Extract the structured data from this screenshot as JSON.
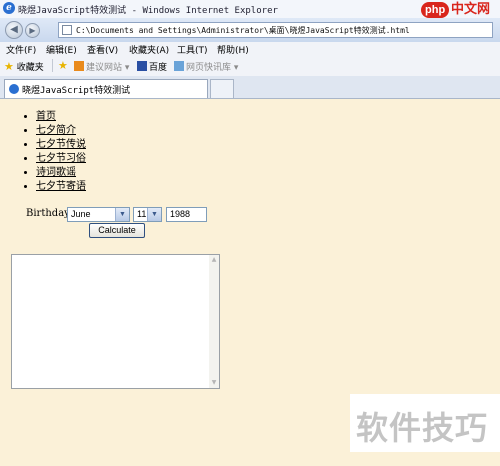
{
  "window": {
    "title": "晓煜JavaScript特效测试 - Windows Internet Explorer"
  },
  "watermark_top": {
    "brand": "php",
    "text": "中文网"
  },
  "address": {
    "url": "C:\\Documents and Settings\\Administrator\\桌面\\晓煜JavaScript特效测试.html"
  },
  "menu": {
    "items": [
      "文件(F)",
      "编辑(E)",
      "查看(V)",
      "收藏夹(A)",
      "工具(T)",
      "帮助(H)"
    ]
  },
  "favorites": {
    "label": "收藏夹",
    "item1": "建议网站 ▾",
    "item2": "百度",
    "item3": "网页快讯库 ▾"
  },
  "tab": {
    "title": "晓煜JavaScript特效测试"
  },
  "nav": {
    "links": [
      "首页",
      "七夕简介",
      "七夕节传说",
      "七夕节习俗",
      "诗词歌谣",
      "七夕节寄语"
    ]
  },
  "form": {
    "birthday_label": "Birthday:",
    "month": "June",
    "day": "11",
    "year": "1988",
    "button": "Calculate"
  },
  "watermark_bottom": {
    "text": "软件技巧"
  }
}
